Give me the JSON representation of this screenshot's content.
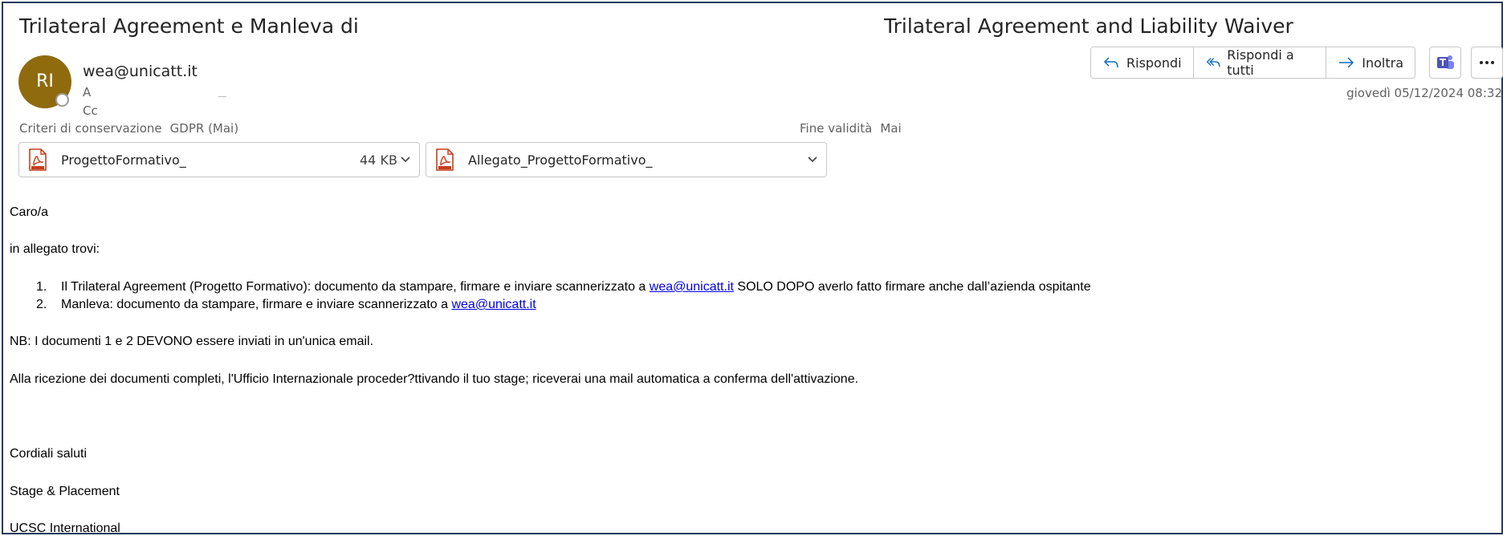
{
  "subject": {
    "left": "Trilateral Agreement e Manleva di",
    "right": "Trilateral Agreement and Liability Waiver"
  },
  "sender": {
    "initials": "RI",
    "email": "wea@unicatt.it",
    "to_label": "A",
    "cc_label": "Cc"
  },
  "retention": {
    "label": "Criteri di conservazione",
    "value": "GDPR (Mai)",
    "expiry_label": "Fine validità",
    "expiry_value": "Mai"
  },
  "attachments": [
    {
      "name": "ProgettoFormativo_",
      "size": "44 KB",
      "icon": "pdf-icon"
    },
    {
      "name": "Allegato_ProgettoFormativo_",
      "size": "",
      "icon": "pdf-icon"
    }
  ],
  "actions": {
    "reply": "Rispondi",
    "reply_all": "Rispondi a tutti",
    "forward": "Inoltra",
    "teams_icon": "teams-icon",
    "more_icon": "more-icon"
  },
  "date": "giovedì 05/12/2024 08:32",
  "body": {
    "greeting": "Caro/a",
    "intro": "in allegato trovi:",
    "items": [
      {
        "num": "1.",
        "text_before": "Il Trilateral Agreement (Progetto Formativo): documento da stampare, firmare e inviare scannerizzato a ",
        "link": "wea@unicatt.it",
        "text_after": " SOLO DOPO averlo fatto firmare anche dall’azienda ospitante"
      },
      {
        "num": "2.",
        "text_before": "Manleva: documento da stampare, firmare e inviare scannerizzato a ",
        "link": "wea@unicatt.it",
        "text_after": ""
      }
    ],
    "nb": "NB: I documenti 1 e 2 DEVONO essere inviati in un'unica email.",
    "reception": "Alla ricezione dei documenti completi, l'Ufficio Internazionale proceder?ttivando il tuo stage; riceverai una mail automatica a conferma dell'attivazione.",
    "closing": "Cordiali saluti",
    "sig1": "Stage & Placement",
    "sig2": "UCSC International"
  },
  "colors": {
    "avatar": "#8f6b0e",
    "link": "#0000ee",
    "accent": "#0f6cbd",
    "pdf_red": "#c43e1c"
  }
}
